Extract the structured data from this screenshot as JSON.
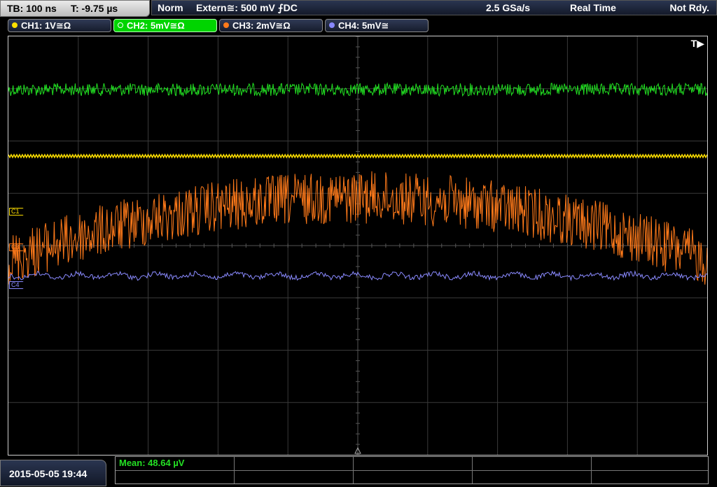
{
  "header": {
    "timebase": "TB: 100 ns",
    "trigger_time": "T: -9.75 µs",
    "mode": "Norm",
    "trigger_source": "Extern≅: 500 mV ⨍DC",
    "sample_rate": "2.5 GSa/s",
    "acq_mode": "Real Time",
    "status": "Not Rdy."
  },
  "channels": [
    {
      "label": "CH1: 1V≅Ω",
      "color": "#ffe000",
      "active": false
    },
    {
      "label": "CH2: 5mV≅Ω",
      "color": "#00d400",
      "active": true
    },
    {
      "label": "CH3: 2mV≅Ω",
      "color": "#ff7a1a",
      "active": false
    },
    {
      "label": "CH4: 5mV≅",
      "color": "#8888ff",
      "active": false
    }
  ],
  "markers": {
    "c1": "C1",
    "c3": "C3",
    "c4": "C4",
    "trigger": "T▶"
  },
  "footer": {
    "datetime": "2015-05-05 19:44",
    "measurement": "Mean: 48.64 µV"
  },
  "colors": {
    "ch1": "#ffe000",
    "ch2": "#22e022",
    "ch3": "#ff7a1a",
    "ch4": "#8a8aff",
    "grid": "#3a3a3a"
  }
}
